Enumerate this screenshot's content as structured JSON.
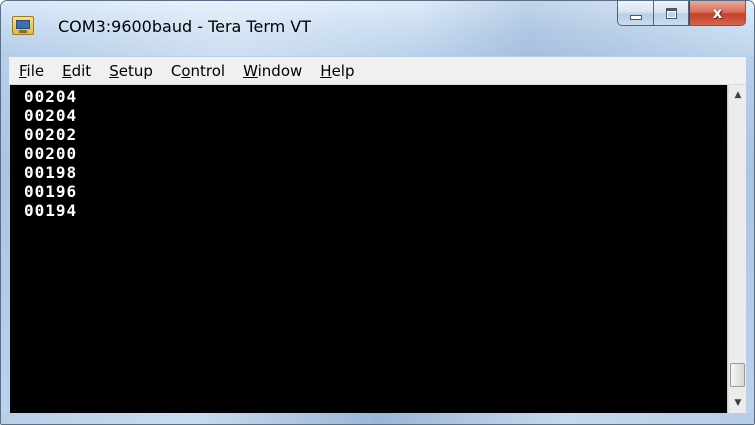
{
  "window": {
    "title": "COM3:9600baud - Tera Term VT",
    "app_icon": "tera-term-icon",
    "controls": {
      "minimize_icon": "minimize-icon",
      "maximize_icon": "maximize-icon",
      "close_icon": "close-icon",
      "close_glyph": "x"
    }
  },
  "menu": {
    "items": [
      {
        "accel": "F",
        "rest": "ile"
      },
      {
        "accel": "E",
        "rest": "dit"
      },
      {
        "accel": "S",
        "rest": "etup"
      },
      {
        "prefix": "C",
        "accel": "o",
        "rest": "ntrol"
      },
      {
        "accel": "W",
        "rest": "indow"
      },
      {
        "accel": "H",
        "rest": "elp"
      }
    ]
  },
  "terminal": {
    "background": "#000000",
    "foreground": "#ffffff",
    "lines": [
      "00204",
      "00204",
      "00202",
      "00200",
      "00198",
      "00196",
      "00194"
    ]
  },
  "scrollbar": {
    "up_arrow": "▲",
    "down_arrow": "▼",
    "thumb_position": 1.0
  }
}
